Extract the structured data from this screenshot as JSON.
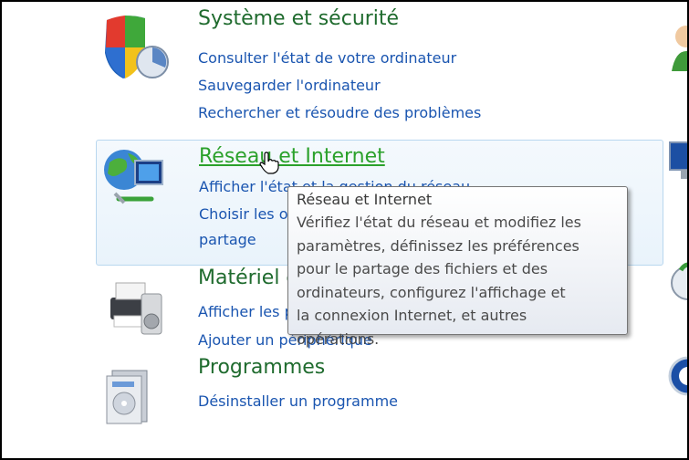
{
  "categories": [
    {
      "title": "Système et sécurité",
      "icon": "shield-icon",
      "links": [
        "Consulter l'état de votre ordinateur",
        "Sauvegarder l'ordinateur",
        "Rechercher et résoudre des problèmes"
      ]
    },
    {
      "title": "Réseau et Internet",
      "icon": "network-globe-icon",
      "links": [
        "Afficher l'état et la gestion du réseau",
        "Choisir les options de groupe résidentiel et de",
        "partage"
      ]
    },
    {
      "title": "Matériel et audio",
      "icon": "printer-icon",
      "links": [
        "Afficher les périphériques et imprimantes",
        "Ajouter un périphérique"
      ]
    },
    {
      "title": "Programmes",
      "icon": "programs-icon",
      "links": [
        "Désinstaller un programme"
      ]
    }
  ],
  "tooltip": {
    "title": "Réseau et Internet",
    "lines": [
      "Vérifiez l'état du réseau et modifiez les",
      "paramètres, définissez les préférences",
      "pour le partage des fichiers et des",
      "ordinateurs, configurez l'affichage et",
      "la connexion Internet, et autres",
      "opérations."
    ]
  },
  "colors": {
    "title_green": "#1f6b2e",
    "title_hover_green": "#2ba12b",
    "link_blue": "#1a55b0",
    "hover_border": "#b9d7ef"
  }
}
